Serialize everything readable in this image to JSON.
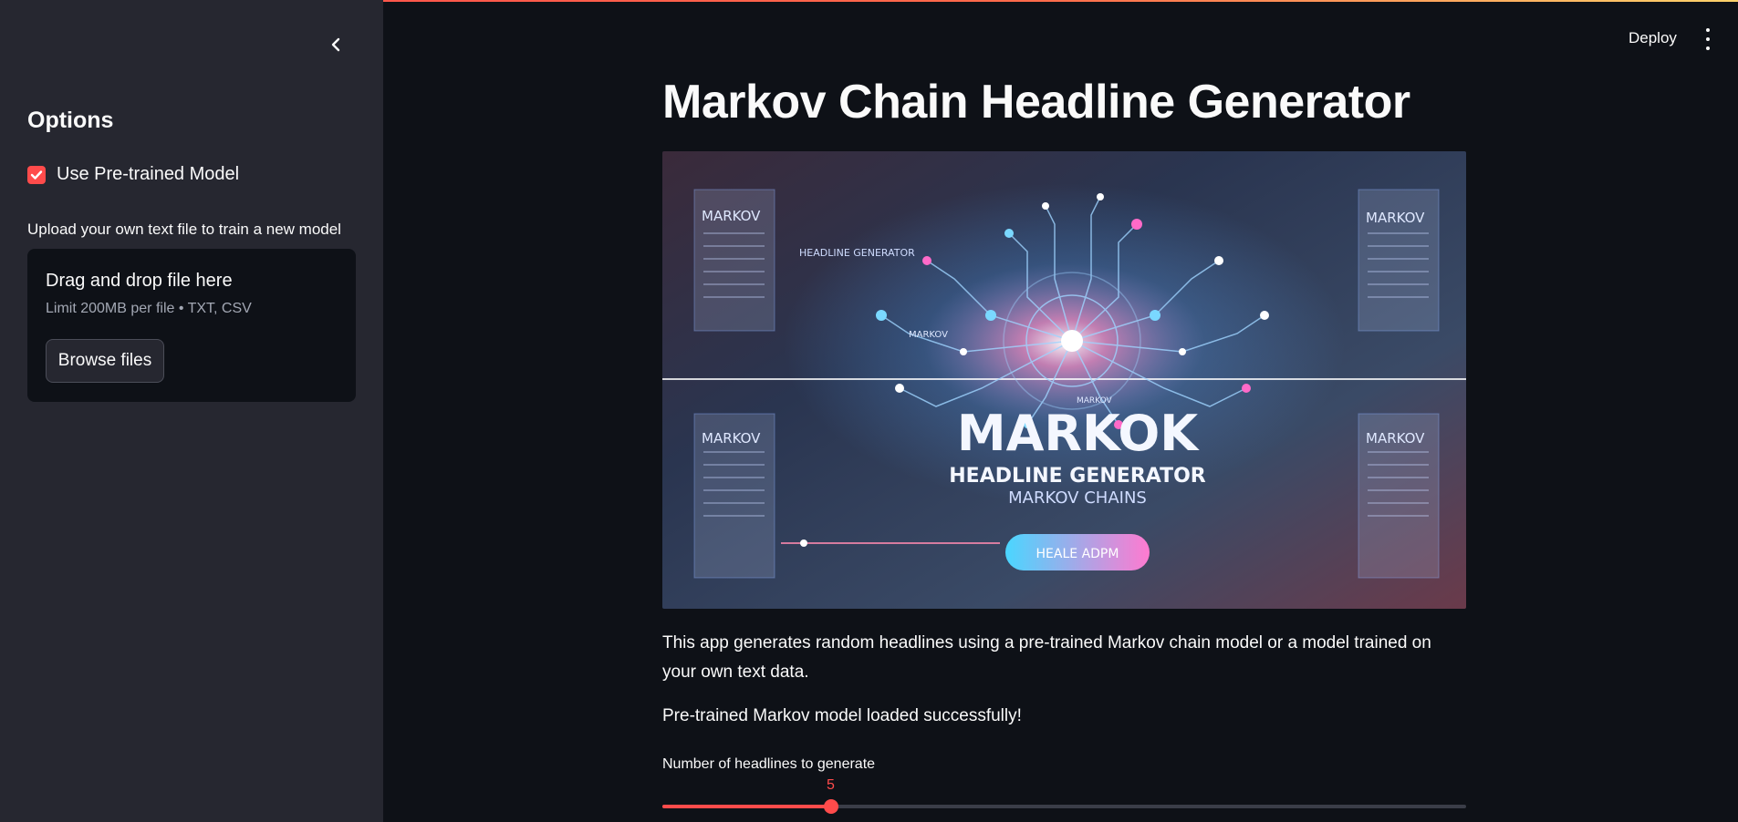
{
  "sidebar": {
    "title": "Options",
    "checkbox": {
      "label": "Use Pre-trained Model",
      "checked": true
    },
    "upload_label": "Upload your own text file to train a new model",
    "dropzone": {
      "title": "Drag and drop file here",
      "limit": "Limit 200MB per file • TXT, CSV",
      "browse_label": "Browse files"
    }
  },
  "header": {
    "deploy_label": "Deploy"
  },
  "main": {
    "title": "Markov Chain Headline Generator",
    "hero_image": {
      "corner_label": "MARKOV",
      "caption_small": "HEADLINE GENERATOR",
      "big_title": "MARKOK",
      "sub_title": "HEADLINE GENERATOR",
      "sub_title2": "MARKOV CHAINS",
      "button_text": "HEALE ADPM",
      "node_label": "MARKOV",
      "node_label2": "MARKOV"
    },
    "description": "This app generates random headlines using a pre-trained Markov chain model or a model trained on your own text data.",
    "status": "Pre-trained Markov model loaded successfully!",
    "slider": {
      "label": "Number of headlines to generate",
      "value": "5",
      "fraction": 0.21
    }
  },
  "colors": {
    "accent": "#ff4b4b",
    "background": "#0e1117",
    "sidebar": "#262730"
  }
}
